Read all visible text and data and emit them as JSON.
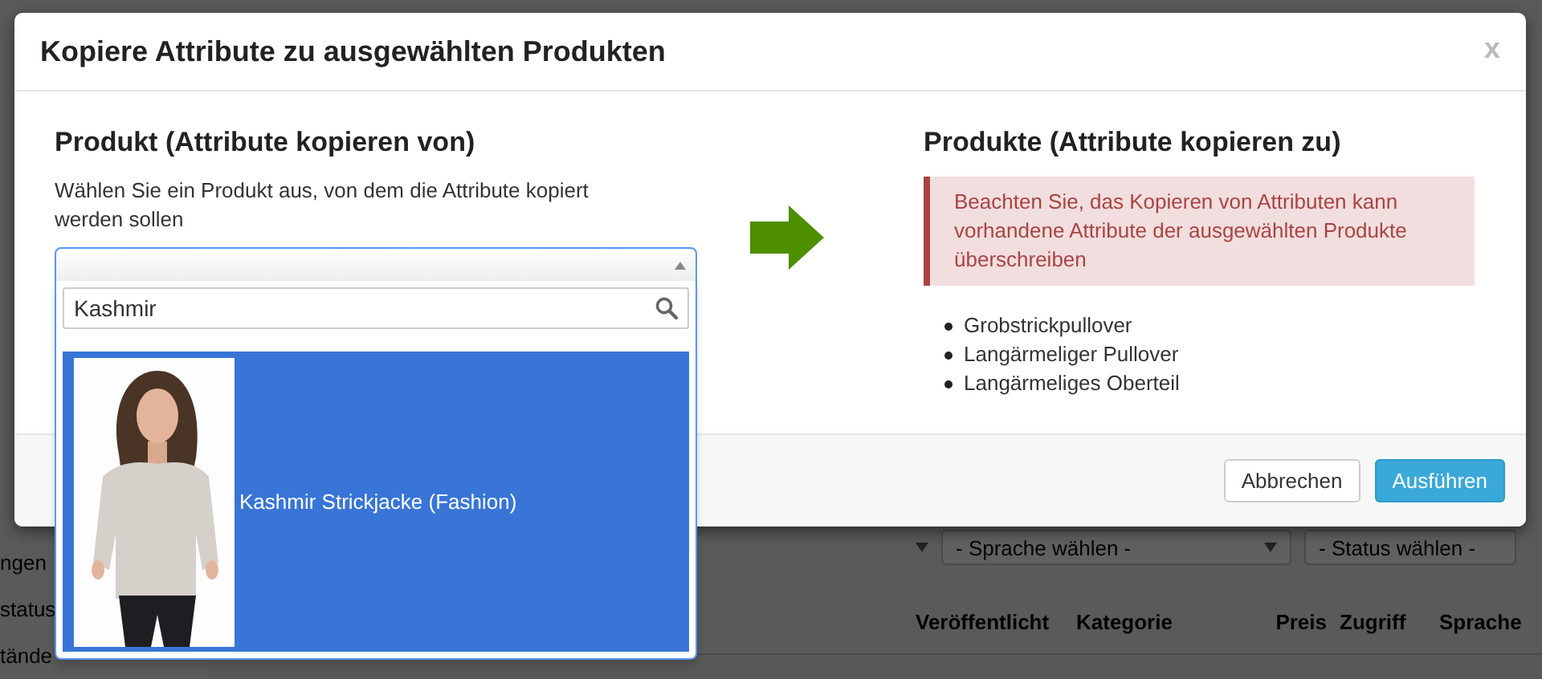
{
  "background": {
    "sidebar_items": [
      "ngen",
      "status",
      "tände"
    ],
    "filters": [
      {
        "value": "- Sprache wählen -"
      },
      {
        "value": "- Status wählen -"
      }
    ],
    "columns": [
      "Veröffentlicht",
      "Kategorie",
      "Preis",
      "Zugriff",
      "Sprache"
    ]
  },
  "dialog": {
    "title": "Kopiere Attribute zu ausgewählten Produkten",
    "close": "x",
    "source": {
      "heading": "Produkt (Attribute kopieren von)",
      "description": "Wählen Sie ein Produkt aus, von dem die Attribute kopiert werden sollen",
      "select": {
        "expanded": true
      },
      "search": {
        "value": "Kashmir"
      },
      "results": [
        {
          "label": "Kashmir Strickjacke (Fashion)",
          "selected": true,
          "kind": "picture"
        }
      ]
    },
    "target": {
      "heading": "Produkte (Attribute kopieren zu)",
      "warning": "Beachten Sie, das Kopieren von Attributen kann vorhandene Attribute der ausgewählten Produkte überschreiben",
      "products": [
        "Grobstrickpullover",
        "Langärmeliger Pullover",
        "Langärmeliges Oberteil"
      ]
    },
    "buttons": [
      {
        "label": "Abbrechen",
        "kind": "default"
      },
      {
        "label": "Ausführen",
        "kind": "primary"
      }
    ]
  }
}
